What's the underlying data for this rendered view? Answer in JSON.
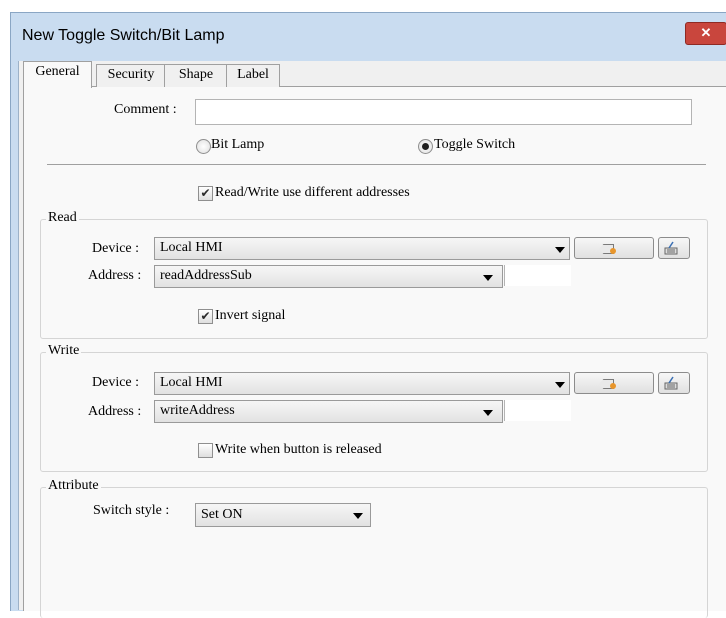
{
  "window": {
    "title": "New Toggle Switch/Bit Lamp",
    "close_label": "✕"
  },
  "tabs": [
    "General",
    "Security",
    "Shape",
    "Label"
  ],
  "general": {
    "comment_label": "Comment :",
    "comment_value": "",
    "mode_bit_lamp": "Bit Lamp",
    "mode_toggle_switch": "Toggle Switch",
    "mode_selected": "Toggle Switch",
    "rw_different_label": "Read/Write use different addresses",
    "rw_different_checked": true
  },
  "read": {
    "title": "Read",
    "device_label": "Device :",
    "device_value": "Local HMI",
    "address_label": "Address :",
    "address_value": "readAddressSub",
    "invert_label": "Invert signal",
    "invert_checked": true
  },
  "write": {
    "title": "Write",
    "device_label": "Device :",
    "device_value": "Local HMI",
    "address_label": "Address :",
    "address_value": "writeAddress",
    "release_label": "Write when button is released",
    "release_checked": false
  },
  "attribute": {
    "title": "Attribute",
    "switch_style_label": "Switch style :",
    "switch_style_value": "Set ON"
  },
  "icons": {
    "close": "close-icon",
    "tag_settings": "address-tag-icon",
    "keypad": "address-keypad-icon",
    "dropdown": "chevron-down-icon"
  },
  "colors": {
    "title_bar": "#c9dcf0",
    "close_button": "#c9463d",
    "panel": "#f9f9f9",
    "dialog": "#f0f0f0"
  }
}
